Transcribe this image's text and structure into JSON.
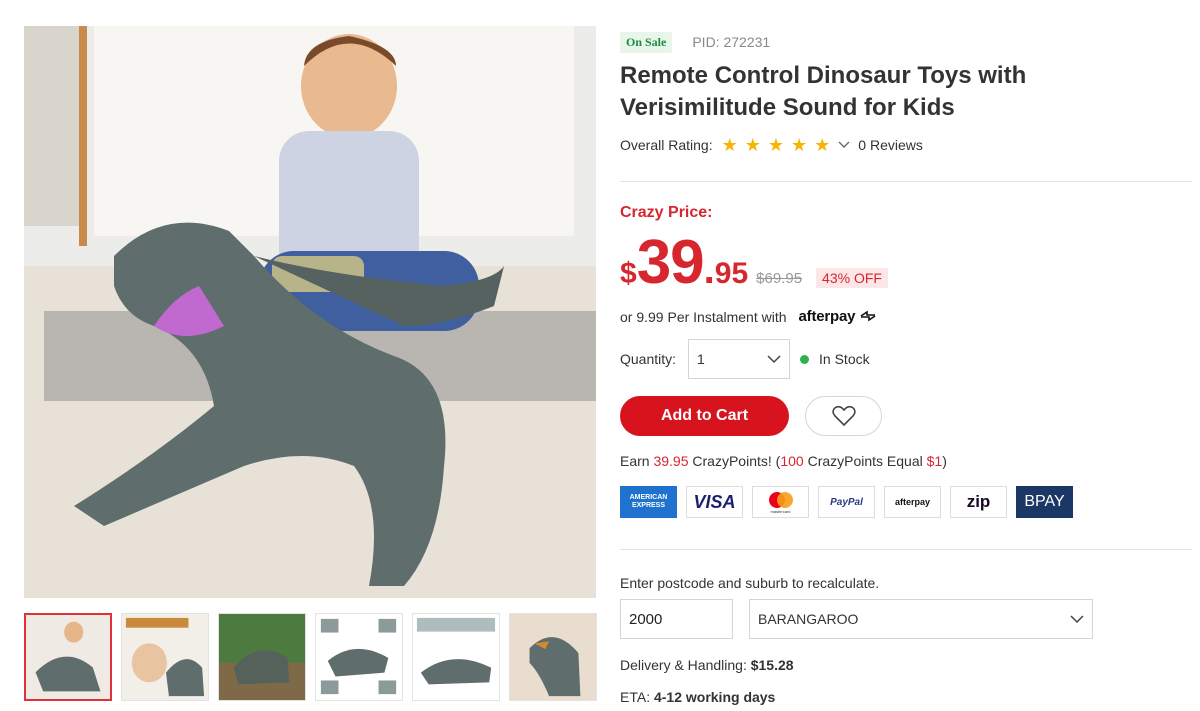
{
  "product": {
    "sale_badge": "On Sale",
    "pid": "PID: 272231",
    "title": "Remote Control Dinosaur Toys with Verisimilitude Sound for Kids",
    "rating_label": "Overall Rating:",
    "stars": 5,
    "reviews": "0 Reviews"
  },
  "price": {
    "label": "Crazy Price:",
    "currency": "$",
    "whole": "39",
    "dot": ".",
    "cents": "95",
    "old": "$69.95",
    "off": "43% OFF",
    "instalment_text": "or 9.99 Per Instalment with",
    "instalment_brand": "afterpay"
  },
  "quantity": {
    "label": "Quantity:",
    "value": "1",
    "stock": "In Stock"
  },
  "actions": {
    "add_to_cart": "Add to Cart"
  },
  "points": {
    "earn": "Earn",
    "amount": "39.95",
    "text1": "CrazyPoints! (",
    "rate": "100",
    "text2": "CrazyPoints Equal",
    "value": "$1",
    "close": ")"
  },
  "payments": [
    "AMERICAN EXPRESS",
    "VISA",
    "mastercard",
    "PayPal",
    "afterpay",
    "zip",
    "BPAY"
  ],
  "shipping": {
    "postcode_label": "Enter postcode and suburb to recalculate.",
    "postcode": "2000",
    "suburb": "BARANGAROO",
    "delivery_label": "Delivery & Handling:",
    "delivery_value": "$15.28",
    "eta_label": "ETA:",
    "eta_value": "4-12 working days"
  },
  "colors": {
    "accent": "#d7131e",
    "price": "#d7262d",
    "star": "#f7b500",
    "stock": "#2bb24c",
    "sale_badge_bg": "#e8f6ea"
  }
}
